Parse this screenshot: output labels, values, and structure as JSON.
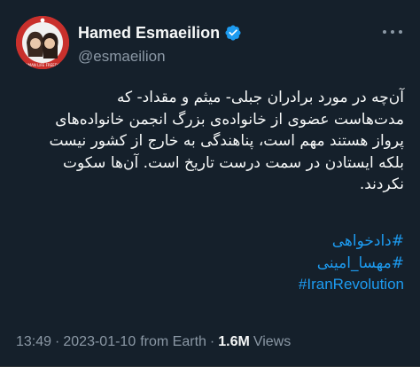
{
  "author": {
    "display_name": "Hamed Esmaeilion",
    "handle": "@esmaeilion",
    "verified": true,
    "avatar_text": "WOMAN LIFE FREEDOM"
  },
  "tweet": {
    "lines": [
      "آن‌چه در مورد برادران جبلی- میثم و مقداد- که",
      "مدت‌هاست عضوی از خانواده‌ی بزرگ انجمن خانواده‌های",
      "پرواز هستند مهم است، پناهندگی به خارج از کشور نیست",
      "بلکه ایستادن در سمت درست تاریخ است. آن‌ها سکوت",
      "نکردند."
    ],
    "hashtags": [
      "#دادخواهی",
      "#مهسا_امینی",
      "#IranRevolution"
    ]
  },
  "meta": {
    "time": "13:49",
    "date": "2023-01-10",
    "source": "from Earth",
    "views_count": "1.6M",
    "views_label": "Views",
    "separator": "·"
  },
  "colors": {
    "background": "#15202b",
    "text": "#f7f9f9",
    "secondary": "#8b98a5",
    "link": "#1d9bf0"
  }
}
